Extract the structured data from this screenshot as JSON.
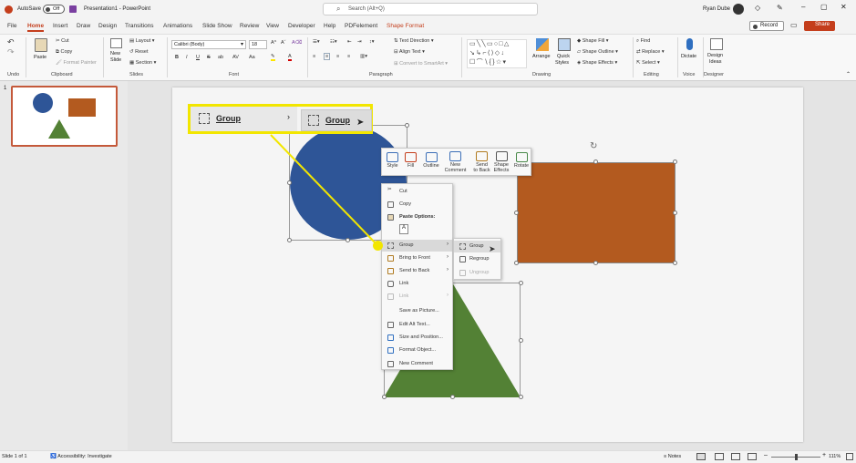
{
  "titlebar": {
    "autosave_label": "AutoSave",
    "autosave_state": "Off",
    "doc_title": "Presentation1 - PowerPoint",
    "search_placeholder": "Search (Alt+Q)",
    "user_name": "Ryan Dube"
  },
  "ribbon_tabs": [
    "File",
    "Home",
    "Insert",
    "Draw",
    "Design",
    "Transitions",
    "Animations",
    "Slide Show",
    "Review",
    "View",
    "Developer",
    "Help",
    "PDFelement",
    "Shape Format"
  ],
  "active_tab": "Home",
  "record_label": "Record",
  "share_label": "Share",
  "ribbon": {
    "undo_label": "Undo",
    "clipboard": {
      "paste": "Paste",
      "cut": "Cut",
      "copy": "Copy",
      "format_painter": "Format Painter",
      "label": "Clipboard"
    },
    "slides": {
      "new_slide": "New",
      "new_slide2": "Slide",
      "layout": "Layout",
      "reset": "Reset",
      "section": "Section",
      "label": "Slides"
    },
    "font": {
      "name": "Calibri (Body)",
      "size": "18",
      "label": "Font",
      "buttons": [
        "B",
        "I",
        "U",
        "S",
        "ab",
        "AV",
        "Aa"
      ]
    },
    "paragraph": {
      "text_direction": "Text Direction",
      "align_text": "Align Text",
      "convert_smartart": "Convert to SmartArt",
      "label": "Paragraph"
    },
    "drawing": {
      "arrange": "Arrange",
      "quick_styles": "Quick",
      "quick_styles2": "Styles",
      "shape_fill": "Shape Fill",
      "shape_outline": "Shape Outline",
      "shape_effects": "Shape Effects",
      "label": "Drawing"
    },
    "editing": {
      "find": "Find",
      "replace": "Replace",
      "select": "Select",
      "label": "Editing"
    },
    "voice": {
      "dictate": "Dictate",
      "label": "Voice"
    },
    "designer": {
      "ideas": "Design",
      "ideas2": "Ideas",
      "label": "Designer"
    }
  },
  "thumb_number": "1",
  "mini_toolbar": [
    "Style",
    "Fill",
    "Outline",
    "New",
    "Comment",
    "Send",
    "to Back",
    "Shape",
    "Effects",
    "Rotate"
  ],
  "context_menu": {
    "items": [
      "Cut",
      "Copy",
      "Paste Options:",
      "Group",
      "Bring to Front",
      "Send to Back",
      "Link",
      "Link",
      "Save as Picture...",
      "Edit Alt Text...",
      "Size and Position...",
      "Format Object...",
      "New Comment"
    ]
  },
  "submenu": [
    "Group",
    "Regroup",
    "Ungroup"
  ],
  "callout": {
    "left_label": "Group",
    "right_label": "Group",
    "accent": "#f2e600"
  },
  "colors": {
    "circle": "#2e5597",
    "rect": "#b35a1f",
    "triangle": "#538135",
    "share": "#c43e1c"
  },
  "status": {
    "slide": "Slide 1 of 1",
    "accessibility": "Accessibility: Investigate",
    "notes": "Notes",
    "zoom": "111%"
  }
}
